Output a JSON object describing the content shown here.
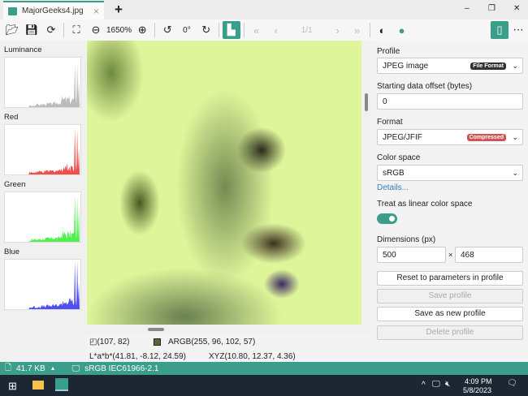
{
  "tab": {
    "title": "MajorGeeks4.jpg",
    "close": "×",
    "new": "+"
  },
  "window": {
    "minimize": "–",
    "restore": "❐",
    "close": "✕"
  },
  "toolbar": {
    "zoom": "1650%",
    "rotation": "0°",
    "page": "1/1"
  },
  "histograms": [
    {
      "label": "Luminance",
      "color": "#aaaaaa"
    },
    {
      "label": "Red",
      "color": "#ee2222"
    },
    {
      "label": "Green",
      "color": "#22ee22"
    },
    {
      "label": "Blue",
      "color": "#2222ee"
    }
  ],
  "info": {
    "coords": "(107, 82)",
    "argb": "ARGB(255, 96, 102, 57)",
    "swatch": "#606639",
    "lab": "L*a*b*(41.81, -8.12, 24.59)",
    "xyz": "XYZ(10.80, 12.37, 4.36)"
  },
  "panel": {
    "profile_label": "Profile",
    "profile_value": "JPEG image",
    "profile_badge": "File Format",
    "offset_label": "Starting data offset (bytes)",
    "offset_value": "0",
    "format_label": "Format",
    "format_value": "JPEG/JFIF",
    "format_badge": "Compressed",
    "colorspace_label": "Color space",
    "colorspace_value": "sRGB",
    "details_link": "Details...",
    "linear_label": "Treat as linear color space",
    "linear_on": true,
    "dimensions_label": "Dimensions (px)",
    "width": "500",
    "height": "468",
    "times": "×",
    "reset_button": "Reset to parameters in profile",
    "save_button": "Save profile",
    "save_new_button": "Save as new profile",
    "delete_button": "Delete profile"
  },
  "status": {
    "size": "41.7 KB",
    "profile": "sRGB IEC61966-2.1"
  },
  "taskbar": {
    "time": "4:09 PM",
    "date": "5/8/2023"
  },
  "colors": {
    "accent": "#3a9e8a",
    "taskbar": "#1c2733"
  }
}
